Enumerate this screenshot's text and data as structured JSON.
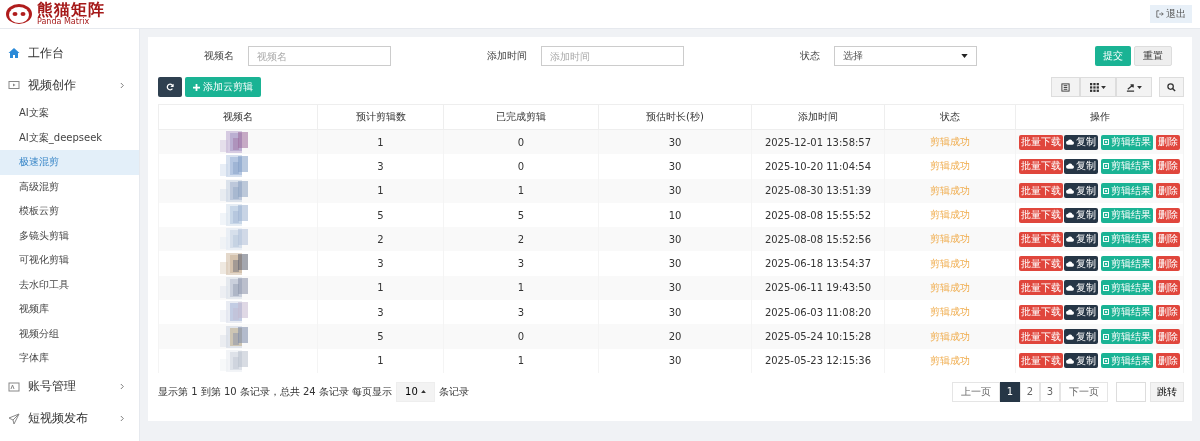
{
  "header": {
    "logo_text": "熊猫矩阵",
    "logo_subtitle": "Panda Matrix",
    "logout": "退出"
  },
  "sidebar": {
    "items": [
      {
        "label": "工作台",
        "has_arrow": false
      },
      {
        "label": "视频创作",
        "has_arrow": true,
        "children": [
          {
            "label": "AI文案",
            "selected": false
          },
          {
            "label": "AI文案_deepseek",
            "selected": false
          },
          {
            "label": "极速混剪",
            "selected": true
          },
          {
            "label": "高级混剪",
            "selected": false
          },
          {
            "label": "模板云剪",
            "selected": false
          },
          {
            "label": "多镜头剪辑",
            "selected": false
          },
          {
            "label": "可视化剪辑",
            "selected": false
          },
          {
            "label": "去水印工具",
            "selected": false
          },
          {
            "label": "视频库",
            "selected": false
          },
          {
            "label": "视频分组",
            "selected": false
          },
          {
            "label": "字体库",
            "selected": false
          }
        ]
      },
      {
        "label": "账号管理",
        "has_arrow": true
      },
      {
        "label": "短视频发布",
        "has_arrow": true
      }
    ]
  },
  "filters": [
    {
      "kind": "text",
      "label": "视频名",
      "placeholder": "视频名"
    },
    {
      "kind": "text",
      "label": "添加时间",
      "placeholder": "添加时间"
    },
    {
      "kind": "select",
      "label": "状态",
      "value": "选择"
    }
  ],
  "filter_buttons": [
    {
      "kind": "primary",
      "label": "提交"
    },
    {
      "kind": "default",
      "label": "重置"
    }
  ],
  "toolbar": {
    "add_button": "添加云剪辑"
  },
  "table": {
    "columns": [
      "视频名",
      "预计剪辑数",
      "已完成剪辑",
      "预估时长(秒)",
      "添加时间",
      "状态",
      "操作"
    ],
    "rows": [
      {
        "planned": "1",
        "done": "0",
        "duration": "30",
        "added": "2025-12-01 13:58:57",
        "status": "剪辑成功",
        "actions": [
          "批量下载",
          "复制",
          "剪辑结果",
          "删除"
        ]
      },
      {
        "planned": "3",
        "done": "0",
        "duration": "30",
        "added": "2025-10-20 11:04:54",
        "status": "剪辑成功",
        "actions": [
          "批量下载",
          "复制",
          "剪辑结果",
          "删除"
        ]
      },
      {
        "planned": "1",
        "done": "1",
        "duration": "30",
        "added": "2025-08-30 13:51:39",
        "status": "剪辑成功",
        "actions": [
          "批量下载",
          "复制",
          "剪辑结果",
          "删除"
        ]
      },
      {
        "planned": "5",
        "done": "5",
        "duration": "10",
        "added": "2025-08-08 15:55:52",
        "status": "剪辑成功",
        "actions": [
          "批量下载",
          "复制",
          "剪辑结果",
          "删除"
        ]
      },
      {
        "planned": "2",
        "done": "2",
        "duration": "30",
        "added": "2025-08-08 15:52:56",
        "status": "剪辑成功",
        "actions": [
          "批量下载",
          "复制",
          "剪辑结果",
          "删除"
        ]
      },
      {
        "planned": "3",
        "done": "3",
        "duration": "30",
        "added": "2025-06-18 13:54:37",
        "status": "剪辑成功",
        "actions": [
          "批量下载",
          "复制",
          "剪辑结果",
          "删除"
        ]
      },
      {
        "planned": "1",
        "done": "1",
        "duration": "30",
        "added": "2025-06-11 19:43:50",
        "status": "剪辑成功",
        "actions": [
          "批量下载",
          "复制",
          "剪辑结果",
          "删除"
        ]
      },
      {
        "planned": "3",
        "done": "3",
        "duration": "30",
        "added": "2025-06-03 11:08:20",
        "status": "剪辑成功",
        "actions": [
          "批量下载",
          "复制",
          "剪辑结果",
          "删除"
        ]
      },
      {
        "planned": "5",
        "done": "0",
        "duration": "20",
        "added": "2025-05-24 10:15:28",
        "status": "剪辑成功",
        "actions": [
          "批量下载",
          "复制",
          "剪辑结果",
          "删除"
        ]
      },
      {
        "planned": "1",
        "done": "1",
        "duration": "30",
        "added": "2025-05-23 12:15:36",
        "status": "剪辑成功",
        "actions": [
          "批量下载",
          "复制",
          "剪辑结果",
          "删除"
        ]
      }
    ]
  },
  "footer": {
    "summary": "显示第 1 到第 10 条记录，总共 24 条记录 每页显示",
    "page_size": "10",
    "suffix": "条记录"
  },
  "pagination": {
    "prev": "上一页",
    "pages": [
      {
        "label": "1",
        "selected": true
      },
      {
        "label": "2",
        "selected": false
      },
      {
        "label": "3",
        "selected": false
      }
    ],
    "next": "下一页",
    "jump": "跳转"
  }
}
